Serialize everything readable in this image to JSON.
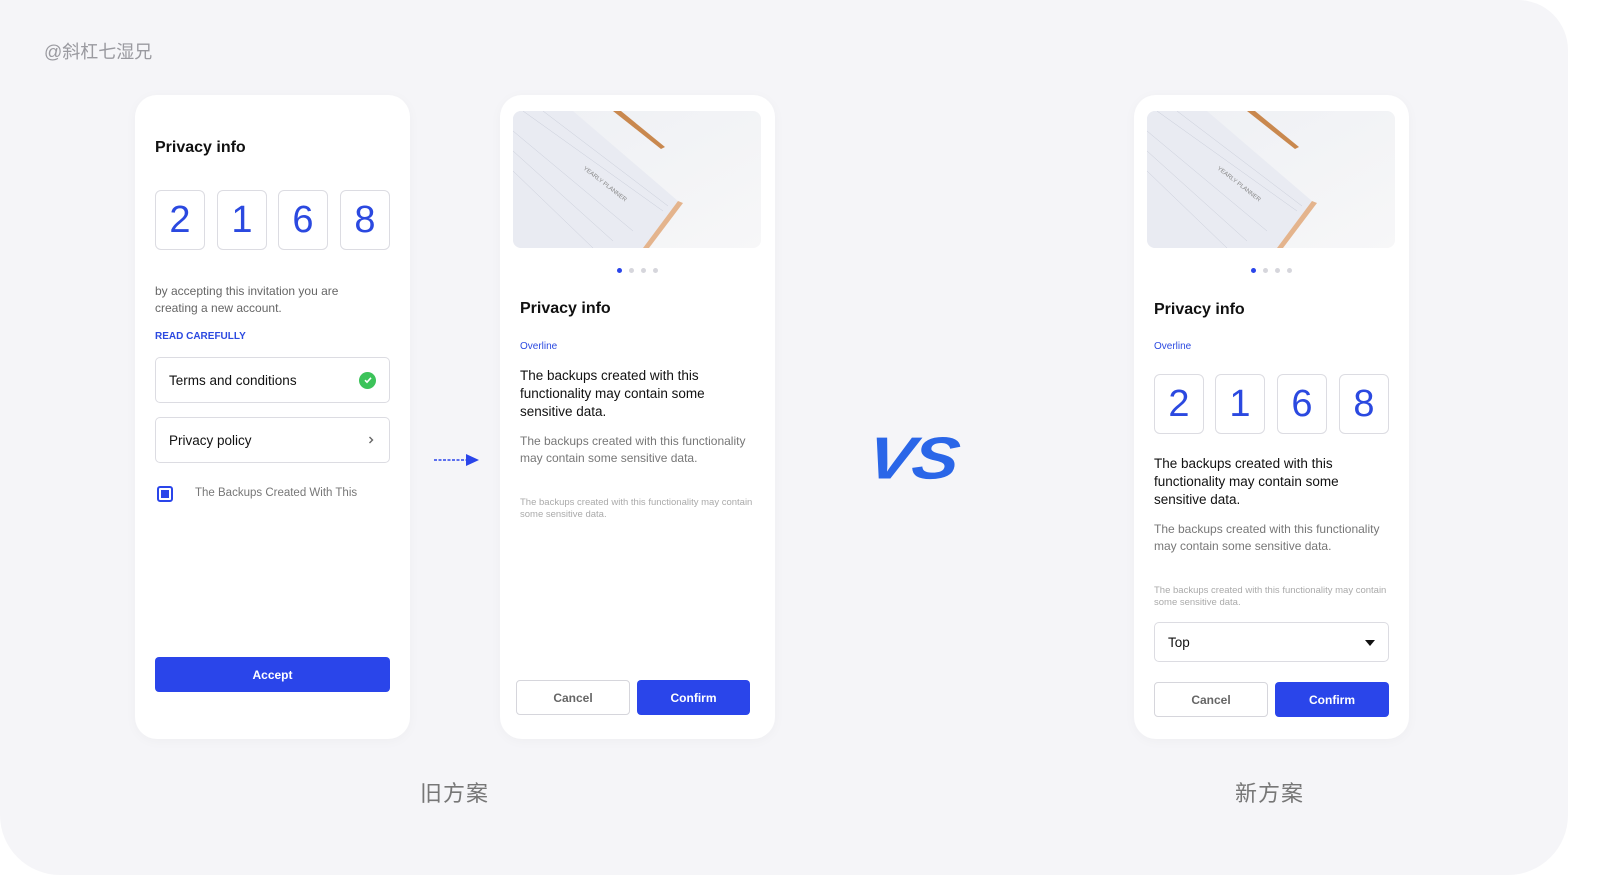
{
  "watermark": "@斜杠七湿兄",
  "colors": {
    "accent": "#2a45ea",
    "success": "#3cc35a",
    "background": "#f5f5f8"
  },
  "old_design": {
    "caption": "旧方案",
    "card1": {
      "title": "Privacy info",
      "code": [
        "2",
        "1",
        "6",
        "8"
      ],
      "description": "by accepting this invitation you are creating a new account.",
      "section_label": "READ CAREFULLY",
      "items": [
        {
          "label": "Terms and conditions",
          "icon": "check-circle-icon"
        },
        {
          "label": "Privacy policy",
          "icon": "chevron-right-icon"
        }
      ],
      "checkbox": {
        "label": "The Backups Created With This",
        "checked": true
      },
      "accept_label": "Accept"
    },
    "card2": {
      "image_text": "YEARLY PLANNER",
      "carousel": {
        "count": 4,
        "active": 1
      },
      "title": "Privacy info",
      "overline": "Overline",
      "body_strong": "The backups created with this functionality may contain some sensitive data.",
      "body": "The backups created with this functionality may contain some sensitive data.",
      "caption": "The backups created with this functionality may contain some sensitive data.",
      "cancel_label": "Cancel",
      "confirm_label": "Confirm"
    }
  },
  "vs_label": "VS",
  "new_design": {
    "caption": "新方案",
    "card": {
      "image_text": "YEARLY PLANNER",
      "carousel": {
        "count": 4,
        "active": 1
      },
      "title": "Privacy info",
      "overline": "Overline",
      "code": [
        "2",
        "1",
        "6",
        "8"
      ],
      "body_strong": "The backups created with this functionality may contain some sensitive data.",
      "body": "The backups created with this functionality may contain some sensitive data.",
      "caption": "The backups created with this functionality may contain some sensitive data.",
      "select_value": "Top",
      "cancel_label": "Cancel",
      "confirm_label": "Confirm"
    }
  }
}
